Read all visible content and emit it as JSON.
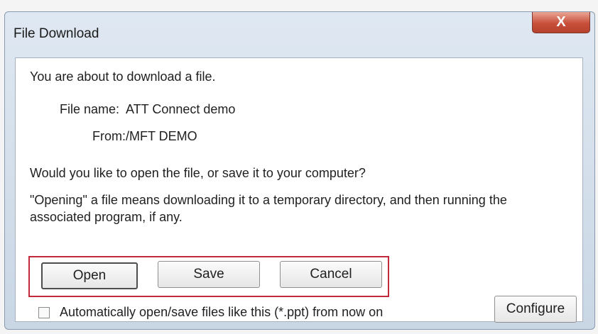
{
  "window": {
    "title": "File Download",
    "close_label": "X"
  },
  "body": {
    "intro": "You are about to download a file.",
    "file_name_label": "File name:",
    "file_name_value": "ATT Connect demo",
    "from_label": "From:",
    "from_value": "/MFT DEMO",
    "question": "Would you like to open the file, or save it to your computer?",
    "explanation_line1": "\"Opening\" a file means downloading it to a temporary directory, and then running the",
    "explanation_line2": "associated program, if any."
  },
  "buttons": {
    "open": "Open",
    "save": "Save",
    "cancel": "Cancel",
    "configure": "Configure"
  },
  "checkbox": {
    "label": "Automatically open/save files like this (*.ppt) from now on",
    "checked": false
  }
}
